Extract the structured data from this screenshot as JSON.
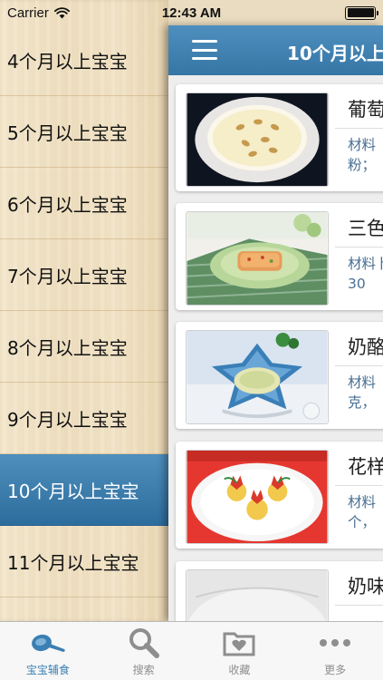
{
  "status_bar": {
    "carrier": "Carrier",
    "time": "12:43 AM"
  },
  "side_menu": {
    "items": [
      {
        "label": "4个月以上宝宝"
      },
      {
        "label": "5个月以上宝宝"
      },
      {
        "label": "6个月以上宝宝"
      },
      {
        "label": "7个月以上宝宝"
      },
      {
        "label": "8个月以上宝宝"
      },
      {
        "label": "9个月以上宝宝"
      },
      {
        "label": "10个月以上宝宝",
        "selected": true
      },
      {
        "label": "11个月以上宝宝"
      }
    ]
  },
  "nav_bar": {
    "title": "10个月以上"
  },
  "recipes": [
    {
      "title": "葡萄",
      "desc": "材料粉；",
      "image": "pudding-bowl"
    },
    {
      "title": "三色",
      "desc": "材料卜30",
      "image": "fish-cake-plate"
    },
    {
      "title": "奶酪",
      "desc": "材料克，",
      "image": "star-bowl"
    },
    {
      "title": "花样",
      "desc": "材料个，",
      "image": "flower-plate"
    },
    {
      "title": "奶味",
      "desc": "",
      "image": "glass-bowl"
    }
  ],
  "tab_bar": {
    "tabs": [
      {
        "label": "宝宝辅食",
        "icon": "spoon-icon",
        "active": true
      },
      {
        "label": "搜索",
        "icon": "search-icon"
      },
      {
        "label": "收藏",
        "icon": "favorites-folder-icon"
      },
      {
        "label": "更多",
        "icon": "more-icon"
      }
    ]
  },
  "colors": {
    "accent": "#3b7fb3",
    "nav": "#4181b0",
    "desc_text": "#4a6f92",
    "tab_inactive": "#8e8e8e"
  }
}
